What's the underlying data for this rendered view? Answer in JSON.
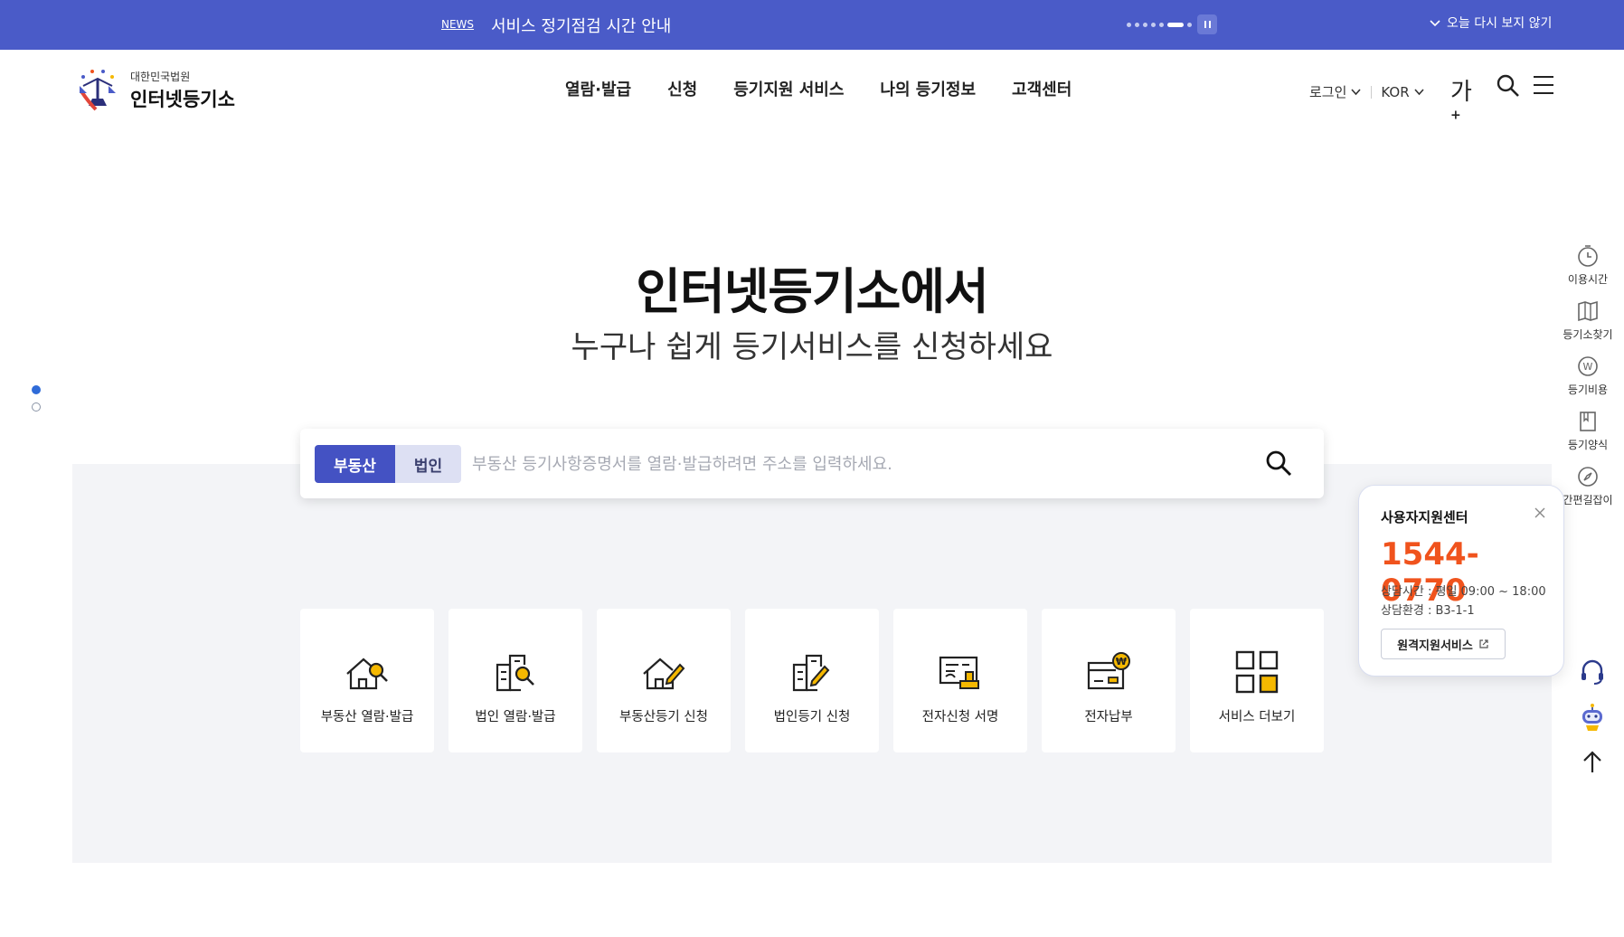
{
  "notice": {
    "tag": "NEWS",
    "message": "서비스 정기점검 시간 안내",
    "dismiss_label": "오늘 다시 보지 않기"
  },
  "logo": {
    "subtitle": "대한민국법원",
    "title": "인터넷등기소"
  },
  "nav": {
    "items": [
      "열람·발급",
      "신청",
      "등기지원 서비스",
      "나의 등기정보",
      "고객센터"
    ]
  },
  "util": {
    "login": "로그인",
    "language": "KOR",
    "font_size": "가"
  },
  "hero": {
    "title": "인터넷등기소에서",
    "subtitle": "누구나 쉽게 등기서비스를 신청하세요"
  },
  "search": {
    "tabs": [
      "부동산",
      "법인"
    ],
    "placeholder": "부동산 등기사항증명서를 열람·발급하려면 주소를 입력하세요."
  },
  "services": [
    {
      "label": "부동산 열람·발급",
      "icon": "house-search-icon"
    },
    {
      "label": "법인 열람·발급",
      "icon": "building-search-icon"
    },
    {
      "label": "부동산등기 신청",
      "icon": "house-pen-icon"
    },
    {
      "label": "법인등기 신청",
      "icon": "building-pen-icon"
    },
    {
      "label": "전자신청 서명",
      "icon": "signature-icon"
    },
    {
      "label": "전자납부",
      "icon": "payment-icon"
    },
    {
      "label": "서비스 더보기",
      "icon": "grid-icon"
    }
  ],
  "quick_menu": [
    {
      "label": "이용시간",
      "icon": "clock-icon"
    },
    {
      "label": "등기소찾기",
      "icon": "map-book-icon"
    },
    {
      "label": "등기비용",
      "icon": "won-coin-icon"
    },
    {
      "label": "등기양식",
      "icon": "form-icon"
    },
    {
      "label": "간편길잡이",
      "icon": "compass-icon"
    }
  ],
  "support": {
    "title": "사용자지원센터",
    "phone": "1544-0770",
    "hours": "상담시간 : 평일 09:00 ~ 18:00",
    "env": "상담환경 : B3-1-1",
    "remote_label": "원격지원서비스"
  },
  "colors": {
    "brand": "#4a5bc8",
    "accent_phone": "#f0531d",
    "icon_highlight": "#f5b800"
  }
}
